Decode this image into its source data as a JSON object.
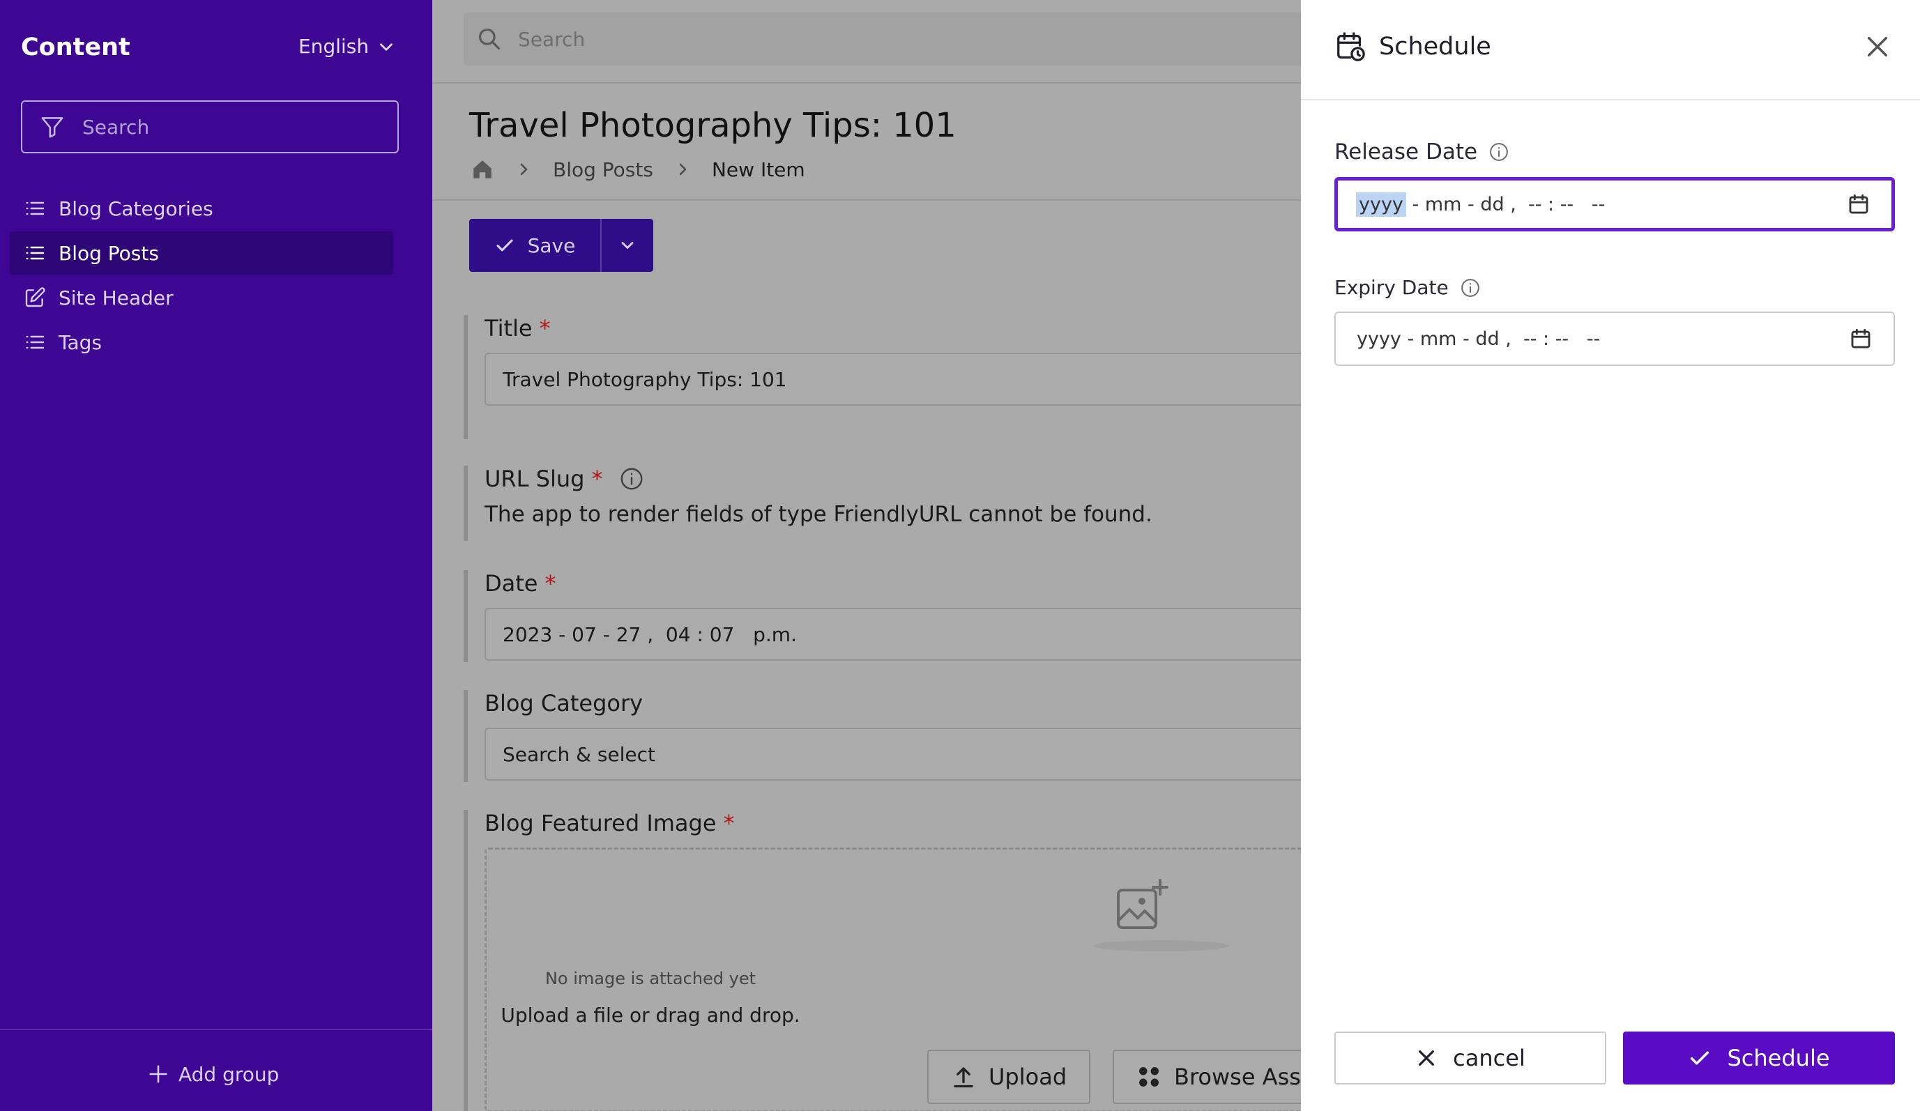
{
  "sidebar": {
    "title": "Content",
    "language": "English",
    "search_placeholder": "Search",
    "items": [
      {
        "label": "Blog Categories",
        "icon": "list-icon",
        "active": false
      },
      {
        "label": "Blog Posts",
        "icon": "list-icon",
        "active": true
      },
      {
        "label": "Site Header",
        "icon": "edit-icon",
        "active": false
      },
      {
        "label": "Tags",
        "icon": "list-icon",
        "active": false
      }
    ],
    "add_group_label": "Add group"
  },
  "main": {
    "search_placeholder": "Search",
    "page_title": "Travel Photography Tips: 101",
    "breadcrumb": [
      "Blog Posts",
      "New Item"
    ],
    "save_label": "Save",
    "fields": {
      "title": {
        "label": "Title",
        "required": "*",
        "value": "Travel Photography Tips: 101"
      },
      "url_slug": {
        "label": "URL Slug",
        "required": "*",
        "message": "The app to render fields of type FriendlyURL cannot be found."
      },
      "date": {
        "label": "Date",
        "required": "*",
        "value": "2023 - 07 - 27 ,  04 : 07   p.m."
      },
      "blog_category": {
        "label": "Blog Category",
        "value": "Search & select"
      },
      "featured_image": {
        "label": "Blog Featured Image",
        "required": "*",
        "no_image_text": "No image is attached yet",
        "upload_hint": "Upload a file or drag and drop.",
        "upload_label": "Upload",
        "browse_label": "Browse Ass"
      }
    }
  },
  "schedule_panel": {
    "title": "Schedule",
    "release_date": {
      "label": "Release Date",
      "year_placeholder": "yyyy",
      "rest_placeholder": " - mm - dd ,  -- : --   --"
    },
    "expiry_date": {
      "label": "Expiry Date",
      "placeholder": "yyyy - mm - dd ,  -- : --   --"
    },
    "cancel_label": "cancel",
    "schedule_label": "Schedule"
  },
  "colors": {
    "sidebar_bg": "#3d0693",
    "primary": "#5a0cc4",
    "focus_border": "#6a1fd4",
    "required": "#b11818"
  }
}
